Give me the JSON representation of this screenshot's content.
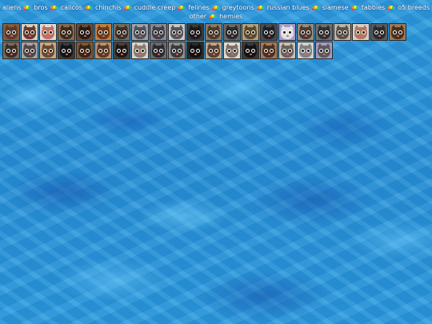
{
  "nav": {
    "row1": [
      {
        "label": "aliens",
        "current": false
      },
      {
        "label": "bros",
        "current": true
      },
      {
        "label": "calicos",
        "current": false
      },
      {
        "label": "chinchis",
        "current": false
      },
      {
        "label": "cuddle creep",
        "current": false
      },
      {
        "label": "felines",
        "current": false
      },
      {
        "label": "greytoons",
        "current": false
      },
      {
        "label": "russian blues",
        "current": false
      },
      {
        "label": "siamese",
        "current": false
      },
      {
        "label": "tabbies",
        "current": false
      },
      {
        "label": "o5 breeds",
        "current": false
      }
    ],
    "row2": [
      {
        "label": "other",
        "current": false
      },
      {
        "label": "hemies",
        "current": false
      }
    ]
  },
  "colors": {
    "water": "#2a94d8",
    "nav_text": "#ffffff",
    "tile_border": "#2a2a2a"
  },
  "tiles": [
    {
      "bg": "#8a5a3a",
      "fur": "#5a3a2a",
      "icon": "brown-cat-icon"
    },
    {
      "bg": "#d8d0c0",
      "fur": "#6a3a2a",
      "icon": "calico-cat-icon"
    },
    {
      "bg": "#e0dcd8",
      "fur": "#c07060",
      "icon": "white-cat-icon"
    },
    {
      "bg": "#8a6a4a",
      "fur": "#3a2a1a",
      "icon": "tabby-cat-icon"
    },
    {
      "bg": "#6a4a3a",
      "fur": "#2a1a12",
      "icon": "dark-cat-icon"
    },
    {
      "bg": "#c08040",
      "fur": "#6a3a1a",
      "icon": "orange-cat-icon"
    },
    {
      "bg": "#7a6a5a",
      "fur": "#3a3028",
      "icon": "grey-brown-cat-icon"
    },
    {
      "bg": "#a0a0a8",
      "fur": "#505058",
      "icon": "grey-cat-icon"
    },
    {
      "bg": "#8a8a92",
      "fur": "#404048",
      "icon": "grey-cat-icon"
    },
    {
      "bg": "#c8c8c8",
      "fur": "#555555",
      "icon": "silver-cat-icon"
    },
    {
      "bg": "#3a3a3a",
      "fur": "#1a1a1a",
      "icon": "black-cat-icon"
    },
    {
      "bg": "#8a7a6a",
      "fur": "#4a3a2a",
      "icon": "tabby-cat-icon"
    },
    {
      "bg": "#6a6a6a",
      "fur": "#2a2a2a",
      "icon": "dark-grey-cat-icon"
    },
    {
      "bg": "#b0a080",
      "fur": "#5a4a2a",
      "icon": "tan-cat-icon"
    },
    {
      "bg": "#4a4a52",
      "fur": "#202024",
      "icon": "black-cat-icon"
    },
    {
      "bg": "#a898c8",
      "fur": "#e0e0e0",
      "icon": "white-cat-icon"
    },
    {
      "bg": "#9a8a7a",
      "fur": "#4a3a30",
      "icon": "tabby-cat-icon"
    },
    {
      "bg": "#707070",
      "fur": "#303030",
      "icon": "grey-cat-icon"
    },
    {
      "bg": "#bcb4a8",
      "fur": "#5a5048",
      "icon": "siamese-cat-icon"
    },
    {
      "bg": "#d8d0c8",
      "fur": "#b07860",
      "icon": "cream-cat-icon"
    },
    {
      "bg": "#5a5a5a",
      "fur": "#2a2a2a",
      "icon": "black-cat-icon"
    },
    {
      "bg": "#9a7a5a",
      "fur": "#4a301a",
      "icon": "brown-cat-icon"
    },
    {
      "bg": "#7a6a5a",
      "fur": "#3a2e24",
      "icon": "tabby-cat-icon"
    },
    {
      "bg": "#aaa0a0",
      "fur": "#504848",
      "icon": "grey-cat-icon"
    },
    {
      "bg": "#c8a888",
      "fur": "#6a4a2a",
      "icon": "ginger-cat-icon"
    },
    {
      "bg": "#3a3a3a",
      "fur": "#141414",
      "icon": "black-cat-icon"
    },
    {
      "bg": "#7a5a3a",
      "fur": "#3a2414",
      "icon": "brown-cat-icon"
    },
    {
      "bg": "#b89070",
      "fur": "#5a3a20",
      "icon": "tabby-cat-icon"
    },
    {
      "bg": "#4a4038",
      "fur": "#1c1814",
      "icon": "dark-cat-icon"
    },
    {
      "bg": "#d8d4cc",
      "fur": "#8a7a6a",
      "icon": "white-cat-icon"
    },
    {
      "bg": "#6a6a70",
      "fur": "#2a2a2e",
      "icon": "grey-cat-icon"
    },
    {
      "bg": "#909090",
      "fur": "#3a3a3a",
      "icon": "grey-cat-icon"
    },
    {
      "bg": "#2a2a2a",
      "fur": "#101010",
      "icon": "black-cat-icon"
    },
    {
      "bg": "#bca48a",
      "fur": "#5a4030",
      "icon": "tabby-cat-icon"
    },
    {
      "bg": "#e0dcd4",
      "fur": "#7a7068",
      "icon": "white-cat-icon"
    },
    {
      "bg": "#3a3a3a",
      "fur": "#121212",
      "icon": "black-cat-icon"
    },
    {
      "bg": "#a07a5a",
      "fur": "#4a3020",
      "icon": "brown-cat-icon"
    },
    {
      "bg": "#c8c0b8",
      "fur": "#6a605a",
      "icon": "silver-cat-icon"
    },
    {
      "bg": "#d0d0d0",
      "fur": "#808080",
      "icon": "white-cat-icon"
    },
    {
      "bg": "#a898c8",
      "fur": "#5a5a5a",
      "icon": "grey-cat-icon"
    }
  ]
}
